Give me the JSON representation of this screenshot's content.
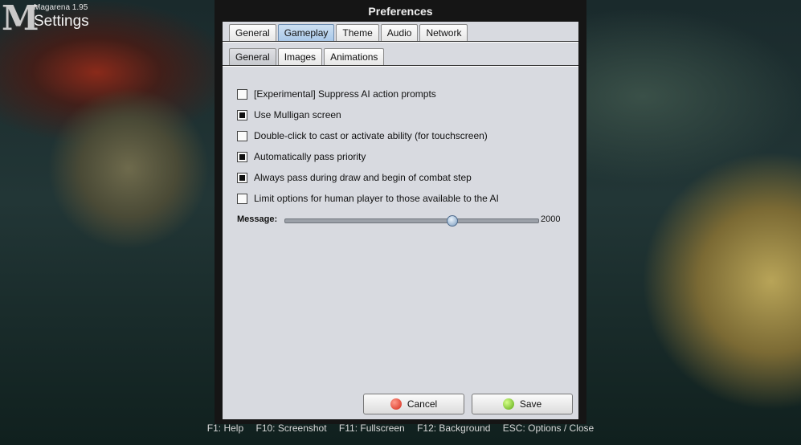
{
  "app": {
    "logo_letter": "M",
    "version": "Magarena 1.95",
    "screen": "Settings"
  },
  "dialog": {
    "title": "Preferences",
    "main_tabs": [
      "General",
      "Gameplay",
      "Theme",
      "Audio",
      "Network"
    ],
    "main_active": "Gameplay",
    "sub_tabs": [
      "General",
      "Images",
      "Animations"
    ],
    "sub_active": "General",
    "options": [
      {
        "label": "[Experimental] Suppress AI action prompts",
        "checked": false
      },
      {
        "label": "Use Mulligan screen",
        "checked": true
      },
      {
        "label": "Double-click to cast or activate ability (for touchscreen)",
        "checked": false
      },
      {
        "label": "Automatically pass priority",
        "checked": true
      },
      {
        "label": "Always pass during draw and begin of combat step",
        "checked": true
      },
      {
        "label": "Limit options for human player to those available to the AI",
        "checked": false
      }
    ],
    "message": {
      "label": "Message:",
      "value": "2000",
      "fraction": 0.66
    },
    "cancel_label": "Cancel",
    "save_label": "Save"
  },
  "footer": [
    "F1: Help",
    "F10: Screenshot",
    "F11: Fullscreen",
    "F12: Background",
    "ESC: Options / Close"
  ],
  "icons": {
    "cancel": "red-circle-icon",
    "save": "green-circle-icon"
  }
}
